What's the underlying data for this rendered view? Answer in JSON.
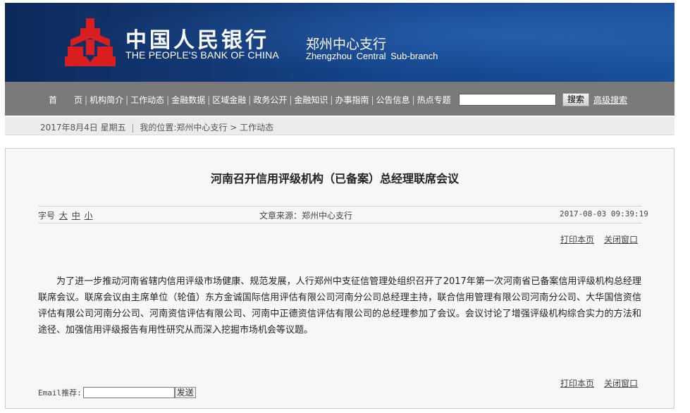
{
  "header": {
    "bank_name_cn": "中国人民银行",
    "bank_name_en": "THE PEOPLE'S BANK OF CHINA",
    "branch_cn": "郑州中心支行",
    "branch_en": "Zhengzhou Central Sub-branch",
    "logo_icon": "pboc-logo-icon",
    "colors": {
      "banner": "#123a78",
      "logo": "#d81e1e"
    }
  },
  "nav": {
    "items": [
      "首　　页",
      "机构简介",
      "工作动态",
      "金融数据",
      "区域金融",
      "政务公开",
      "金融知识",
      "办事指南",
      "公告信息",
      "热点专题"
    ],
    "search_placeholder": "",
    "search_button": "搜索",
    "advanced_search": "高级搜索",
    "color": "#7a7a7a"
  },
  "location": {
    "date": "2017年8月4日",
    "weekday": "星期五",
    "prefix": "我的位置:",
    "crumb_1": "郑州中心支行",
    "crumb_sep": ">",
    "crumb_2": "工作动态"
  },
  "article": {
    "title": "河南召开信用评级机构（已备案）总经理联席会议",
    "font_label": "字号",
    "font_large": "大",
    "font_medium": "中",
    "font_small": "小",
    "source": "文章来源：郑州中心支行",
    "timestamp": "2017-08-03 09:39:19",
    "print": "打印本页",
    "close": "关闭窗口",
    "body": "为了进一步推动河南省辖内信用评级市场健康、规范发展，人行郑州中支征信管理处组织召开了2017年第一次河南省已备案信用评级机构总经理联席会议。联席会议由主席单位（轮值）东方金诚国际信用评估有限公司河南分公司总经理主持，联合信用管理有限公司河南分公司、大华国信资信评估有限公司河南分公司、河南资信评估有限公司、河南中正德资信评估有限公司的总经理参加了会议。会议讨论了增强评级机构综合实力的方法和途径、加强信用评级报告有用性研究从而深入挖掘市场机会等议题。"
  },
  "email": {
    "label": "Email推荐:",
    "value": "",
    "button": "发送"
  }
}
